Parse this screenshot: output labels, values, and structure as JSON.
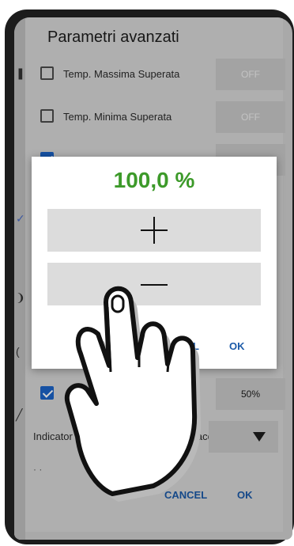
{
  "preferences": {
    "title": "Parametri avanzati",
    "rows": [
      {
        "label": "Temp. Massima Superata",
        "checked": false,
        "value": "OFF"
      },
      {
        "label": "Temp. Minima Superata",
        "checked": false,
        "value": "OFF"
      },
      {
        "label": "",
        "checked": true,
        "value": ""
      },
      {
        "label": "",
        "checked": true,
        "value": "50%"
      }
    ],
    "indicator_label": "Indicator",
    "indicator_tail": "e accesi",
    "actions": {
      "cancel": "CANCEL",
      "ok": "OK"
    }
  },
  "dialog": {
    "value": "100,0 %",
    "plus_label": "+",
    "minus_label": "−",
    "actions": {
      "cancel": "CEL",
      "ok": "OK"
    }
  },
  "colors": {
    "accent_green": "#3d9a2a",
    "checkbox_blue": "#1b63c7",
    "action_blue": "#1b5aa8"
  },
  "icons": [
    "plus-icon",
    "minus-icon",
    "dropdown-arrow-icon",
    "hand-pointer-icon"
  ]
}
